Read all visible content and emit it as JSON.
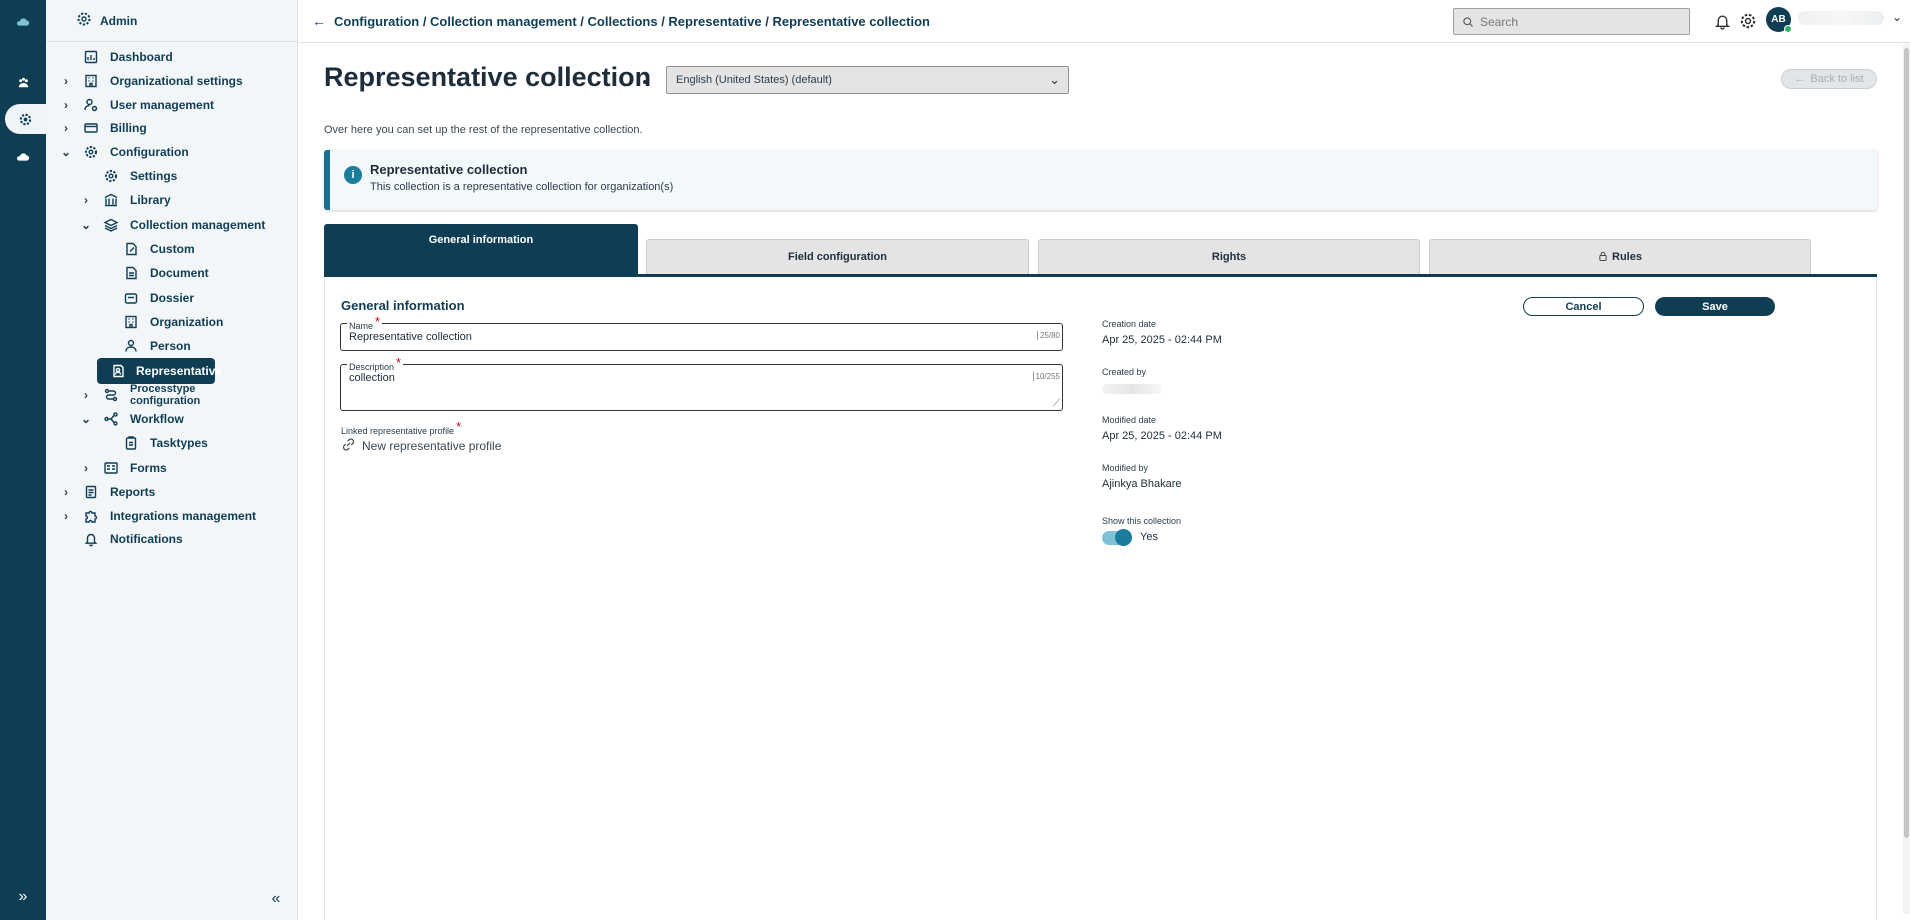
{
  "rail": {
    "items": [
      {
        "icon": "cloud-icon"
      },
      {
        "icon": "paw-icon"
      },
      {
        "icon": "gear-icon"
      },
      {
        "icon": "cloud-icon"
      }
    ],
    "expand_glyph": "»"
  },
  "sidebar": {
    "header": "Admin",
    "collapse_glyph": "«",
    "items": [
      {
        "label": "Dashboard",
        "icon": "dashboard-icon",
        "chevron": ""
      },
      {
        "label": "Organizational settings",
        "icon": "building-icon",
        "chevron": "›"
      },
      {
        "label": "User management",
        "icon": "user-gear-icon",
        "chevron": "›"
      },
      {
        "label": "Billing",
        "icon": "card-icon",
        "chevron": "›"
      },
      {
        "label": "Configuration",
        "icon": "gear-icon",
        "chevron": "⌄"
      },
      {
        "label": "Settings",
        "icon": "gear-icon",
        "chevron": ""
      },
      {
        "label": "Library",
        "icon": "library-icon",
        "chevron": "›"
      },
      {
        "label": "Collection management",
        "icon": "layers-icon",
        "chevron": "⌄"
      },
      {
        "label": "Custom",
        "icon": "document-edit-icon",
        "chevron": ""
      },
      {
        "label": "Document",
        "icon": "document-icon",
        "chevron": ""
      },
      {
        "label": "Dossier",
        "icon": "folder-icon",
        "chevron": ""
      },
      {
        "label": "Organization",
        "icon": "building-icon",
        "chevron": ""
      },
      {
        "label": "Person",
        "icon": "person-icon",
        "chevron": ""
      },
      {
        "label": "Representative",
        "icon": "representative-icon",
        "chevron": ""
      },
      {
        "label": "Processtype",
        "label2": "configuration",
        "icon": "process-icon",
        "chevron": "›"
      },
      {
        "label": "Workflow",
        "icon": "workflow-icon",
        "chevron": "⌄"
      },
      {
        "label": "Tasktypes",
        "icon": "clipboard-icon",
        "chevron": ""
      },
      {
        "label": "Forms",
        "icon": "form-icon",
        "chevron": "›"
      },
      {
        "label": "Reports",
        "icon": "report-icon",
        "chevron": "›"
      },
      {
        "label": "Integrations management",
        "icon": "puzzle-icon",
        "chevron": "›"
      },
      {
        "label": "Notifications",
        "icon": "bell-icon",
        "chevron": ""
      }
    ]
  },
  "topbar": {
    "breadcrumb": "Configuration / Collection management / Collections / Representative / Representative collection",
    "search_placeholder": "Search",
    "avatar_initials": "AB"
  },
  "page": {
    "title": "Representative collection",
    "language": "English (United States) (default)",
    "back_to_list": "Back to list",
    "intro": "Over here you can set up the rest of the representative collection.",
    "info_title": "Representative collection",
    "info_text": "This collection is a representative collection for organization(s)"
  },
  "tabs": [
    {
      "label": "General information",
      "active": true
    },
    {
      "label": "Field configuration",
      "active": false
    },
    {
      "label": "Rights",
      "active": false
    },
    {
      "label": "Rules",
      "active": false,
      "icon": "lock-icon"
    }
  ],
  "form": {
    "section_title": "General information",
    "cancel": "Cancel",
    "save": "Save",
    "name_label": "Name",
    "name_value": "Representative collection",
    "name_counter": "25/80",
    "description_label": "Description",
    "description_value": "collection",
    "description_counter": "10/255",
    "linked_label": "Linked representative profile",
    "linked_action": "New representative profile",
    "required_mark": "*"
  },
  "meta": {
    "creation_date_label": "Creation date",
    "creation_date": "Apr 25, 2025 - 02:44 PM",
    "created_by_label": "Created by",
    "modified_date_label": "Modified date",
    "modified_date": "Apr 25, 2025 - 02:44 PM",
    "modified_by_label": "Modified by",
    "modified_by": "Ajinkya Bhakare",
    "show_label": "Show this collection",
    "show_value": "Yes"
  },
  "colors": {
    "primary": "#0f3d53",
    "accent": "#1b7d9c",
    "required": "#d0021b"
  }
}
